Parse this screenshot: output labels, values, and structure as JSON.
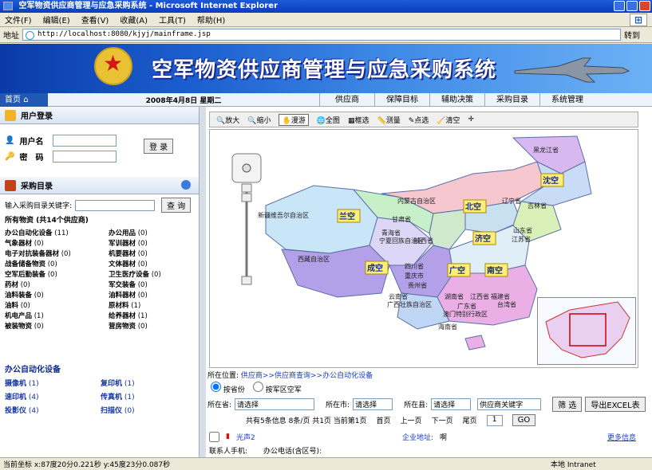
{
  "window": {
    "title": "空军物资供应商管理与应急采购系统 - Microsoft Internet Explorer"
  },
  "menu": [
    "文件(F)",
    "编辑(E)",
    "查看(V)",
    "收藏(A)",
    "工具(T)",
    "帮助(H)"
  ],
  "address": {
    "label": "地址",
    "url": "http://localhost:8080/kjyj/mainframe.jsp",
    "go": "转到"
  },
  "banner": {
    "title": "空军物资供应商管理与应急采购系统"
  },
  "nav": {
    "home": "首页",
    "date": "2008年4月8日 星期二",
    "items": [
      "供应商",
      "保障目标",
      "辅助决策",
      "采购目录",
      "系统管理"
    ]
  },
  "login": {
    "title": "用户登录",
    "user_label": "用户名",
    "pass_label": "密　码",
    "button": "登 录"
  },
  "catalog": {
    "title": "采购目录",
    "search_label": "输入采购目录关键字:",
    "search_button": "查 询",
    "summary": "所有物资 (共14个供应商)",
    "items": [
      [
        "办公自动化设备",
        "(11)"
      ],
      [
        "办公用品",
        "(0)"
      ],
      [
        "气象器材",
        "(0)"
      ],
      [
        "军训器材",
        "(0)"
      ],
      [
        "电子对抗装备器材",
        "(0)"
      ],
      [
        "机要器材",
        "(0)"
      ],
      [
        "战备储备物资",
        "(0)"
      ],
      [
        "文体器材",
        "(0)"
      ],
      [
        "空军后勤装备",
        "(0)"
      ],
      [
        "卫生医疗设备",
        "(0)"
      ],
      [
        "药材",
        "(0)"
      ],
      [
        "军交装备",
        "(0)"
      ],
      [
        "油料装备",
        "(0)"
      ],
      [
        "油料器材",
        "(0)"
      ],
      [
        "油料",
        "(0)"
      ],
      [
        "原材料",
        "(1)"
      ],
      [
        "机电产品",
        "(1)"
      ],
      [
        "给养器材",
        "(1)"
      ],
      [
        "被装物资",
        "(0)"
      ],
      [
        "营房物资",
        "(0)"
      ]
    ]
  },
  "office": {
    "title": "办公自动化设备",
    "items": [
      [
        "摄像机",
        "(1)"
      ],
      [
        "复印机",
        "(1)"
      ],
      [
        "速印机",
        "(4)"
      ],
      [
        "传真机",
        "(1)"
      ],
      [
        "投影仪",
        "(4)"
      ],
      [
        "扫描仪",
        "(0)"
      ]
    ]
  },
  "maptools": [
    "放大",
    "缩小",
    "漫游",
    "全图",
    "框选",
    "测量",
    "点选",
    "清空"
  ],
  "map": {
    "regions": [
      {
        "name": "黑龙江省",
        "color": "#d9b8f0"
      },
      {
        "name": "吉林省",
        "color": "#c9dcf7"
      },
      {
        "name": "辽宁省",
        "color": "#c9dcf7"
      },
      {
        "name": "内蒙古自治区",
        "color": "#f7c7d0"
      },
      {
        "name": "新疆维吾尔自治区",
        "color": "#c9e6f9"
      },
      {
        "name": "甘肃省",
        "color": "#c8f0c8"
      },
      {
        "name": "青海省",
        "color": "#dcd6f7"
      },
      {
        "name": "宁夏回族自治区",
        "color": "#eee"
      },
      {
        "name": "陕西省",
        "color": "#cfe9cf"
      },
      {
        "name": "山东省",
        "color": "#d9f0b8"
      },
      {
        "name": "江苏省",
        "color": "#d9f0b8"
      },
      {
        "name": "西藏自治区",
        "color": "#b4a0e8"
      },
      {
        "name": "四川省",
        "color": "#b4a0e8"
      },
      {
        "name": "重庆市",
        "color": "#c0d6f5"
      },
      {
        "name": "贵州省",
        "color": "#c0d6f5"
      },
      {
        "name": "云南省",
        "color": "#c0d6f5"
      },
      {
        "name": "广西壮族自治区",
        "color": "#c0d6f5"
      },
      {
        "name": "湖南省",
        "color": "#eab0e6"
      },
      {
        "name": "江西省",
        "color": "#eab0e6"
      },
      {
        "name": "福建省",
        "color": "#eab0e6"
      },
      {
        "name": "广东省",
        "color": "#eab0e6"
      },
      {
        "name": "台湾省",
        "color": "#f7c7d0"
      },
      {
        "name": "澳门特别行政区",
        "color": "#eab0e6"
      },
      {
        "name": "海南省",
        "color": "#eab0e6"
      }
    ],
    "commands": [
      "沈空",
      "北空",
      "兰空",
      "济空",
      "成空",
      "广空",
      "南空"
    ]
  },
  "location": {
    "prefix": "所在位置:",
    "path": "供应商>>供应商查询>>办公自动化设备"
  },
  "filter": {
    "radio1": "按省份",
    "radio2": "按军区空军",
    "province_label": "所在省:",
    "city_label": "所在市:",
    "county_label": "所在县:",
    "select_placeholder": "请选择",
    "keyword": "供应商关键字",
    "btn_filter": "筛 选",
    "btn_export": "导出EXCEL表"
  },
  "pager": {
    "summary": "共有5条信息 8条/页 共1页 当前第1页",
    "first": "首页",
    "prev": "上一页",
    "next": "下一页",
    "last": "尾页",
    "page": "1",
    "go": "GO"
  },
  "record": {
    "name": "光声2",
    "address_label": "企业地址:",
    "address": "啊",
    "more": "更多信息",
    "contact": "联系人手机:",
    "phone": "办公电话(含区号):"
  },
  "status": {
    "coords": "当前坐标 x:87度20分0.221秒  y:45度23分0.087秒",
    "zone": "本地 Intranet"
  }
}
